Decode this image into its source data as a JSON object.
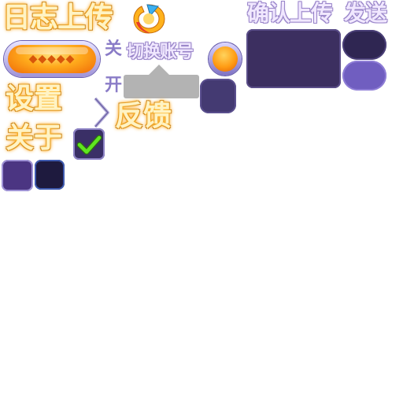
{
  "labels": {
    "log_upload": "日志上传",
    "confirm_upload": "确认上传",
    "send": "发送",
    "off": "关",
    "switch_account": "切换账号",
    "on": "开",
    "settings": "设置",
    "feedback": "反馈",
    "about": "关于"
  },
  "icons": {
    "logo": "tencent-logo-icon",
    "chevron": "chevron-right-icon",
    "check": "checkmark-icon"
  },
  "colors": {
    "gold_text": "#fff3c4",
    "lilac_text": "#f1e8ff",
    "purple_label": "#8a7cc7",
    "panel": "#3c2f60",
    "toggle_on": "#705ec0",
    "toggle_off": "#2f2652",
    "check": "#5fe620",
    "orange": "#ff9c14"
  },
  "checkbox": {
    "checked": true
  }
}
